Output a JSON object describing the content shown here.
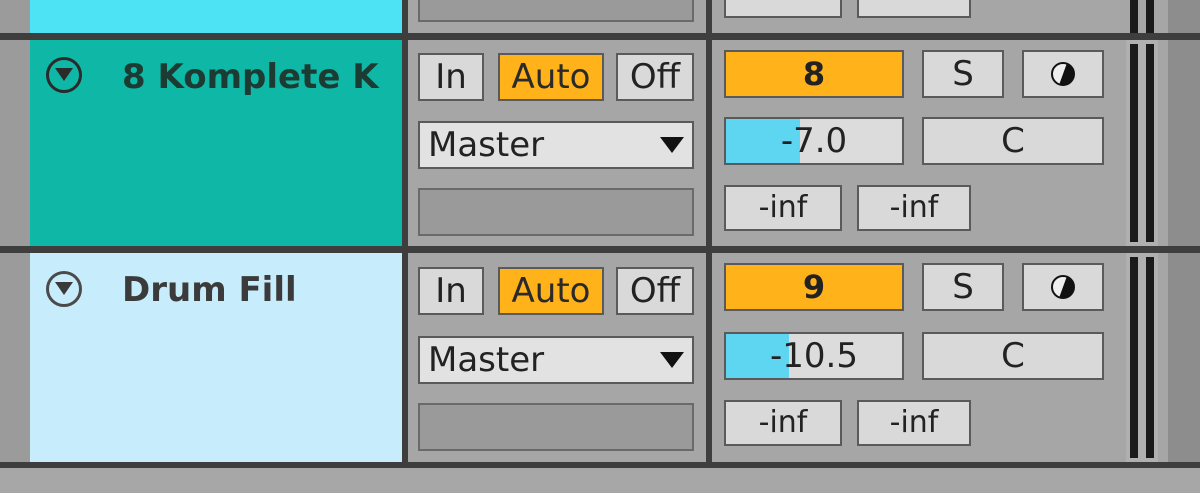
{
  "tracks": [
    {
      "name": "8 Komplete K",
      "monitor": {
        "in": "In",
        "auto": "Auto",
        "off": "Off"
      },
      "output": "Master",
      "number": "8",
      "solo": "S",
      "volume": "-7.0",
      "volume_fraction": 0.42,
      "pan": "C",
      "send_a": "-inf",
      "send_b": "-inf"
    },
    {
      "name": "Drum Fill",
      "monitor": {
        "in": "In",
        "auto": "Auto",
        "off": "Off"
      },
      "output": "Master",
      "number": "9",
      "solo": "S",
      "volume": "-10.5",
      "volume_fraction": 0.36,
      "pan": "C",
      "send_a": "-inf",
      "send_b": "-inf"
    }
  ],
  "colors": {
    "track1": "#0fb8a6",
    "track2": "#c7ecfb",
    "auto_active": "#ffb21a",
    "volume_fill": "#5ed6f2"
  },
  "icons": [
    "fold-triangle-icon",
    "dropdown-arrow-icon",
    "phase-icon"
  ]
}
